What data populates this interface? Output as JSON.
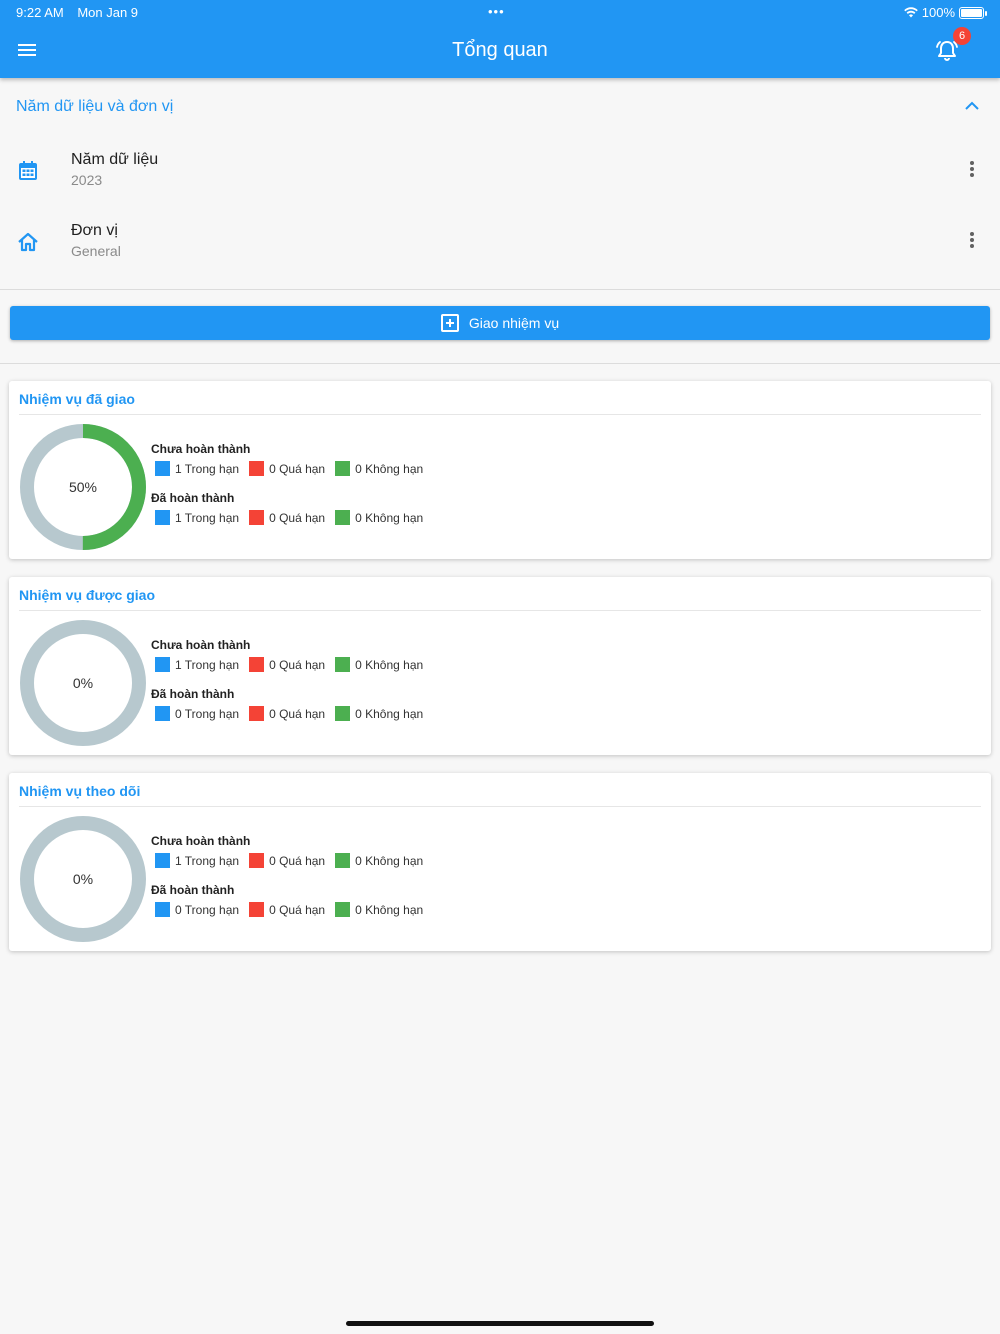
{
  "status_bar": {
    "time": "9:22 AM",
    "date": "Mon Jan 9",
    "dots": "•••",
    "battery": "100%"
  },
  "header": {
    "title": "Tổng quan",
    "notification_count": "6",
    "color": "#2196f3"
  },
  "filter_section": {
    "title": "Năm dữ liệu và đơn vị",
    "year": {
      "label": "Năm dữ liệu",
      "value": "2023",
      "icon": "calendar-icon"
    },
    "unit": {
      "label": "Đơn vị",
      "value": "General",
      "icon": "home-icon"
    }
  },
  "assign_button": {
    "label": "Giao nhiệm vụ",
    "icon": "add-box-icon"
  },
  "colors": {
    "in_time": "#2196f3",
    "overdue": "#f44336",
    "no_deadline": "#4caf50",
    "ring_empty": "#b7c8ce"
  },
  "cards": [
    {
      "title": "Nhiệm vụ đã giao",
      "percent_label": "50%",
      "progress": 0.5,
      "incomplete": {
        "title": "Chưa hoàn thành",
        "in_time": "1 Trong hạn",
        "overdue": "0 Quá hạn",
        "no_deadline": "0 Không hạn"
      },
      "complete": {
        "title": "Đã hoàn thành",
        "in_time": "1 Trong hạn",
        "overdue": "0 Quá hạn",
        "no_deadline": "0 Không hạn"
      }
    },
    {
      "title": "Nhiệm vụ được giao",
      "percent_label": "0%",
      "progress": 0,
      "incomplete": {
        "title": "Chưa hoàn thành",
        "in_time": "1 Trong hạn",
        "overdue": "0 Quá hạn",
        "no_deadline": "0 Không hạn"
      },
      "complete": {
        "title": "Đã hoàn thành",
        "in_time": "0 Trong hạn",
        "overdue": "0 Quá hạn",
        "no_deadline": "0 Không hạn"
      }
    },
    {
      "title": "Nhiệm vụ theo dõi",
      "percent_label": "0%",
      "progress": 0,
      "incomplete": {
        "title": "Chưa hoàn thành",
        "in_time": "1 Trong hạn",
        "overdue": "0 Quá hạn",
        "no_deadline": "0 Không hạn"
      },
      "complete": {
        "title": "Đã hoàn thành",
        "in_time": "0 Trong hạn",
        "overdue": "0 Quá hạn",
        "no_deadline": "0 Không hạn"
      }
    }
  ]
}
